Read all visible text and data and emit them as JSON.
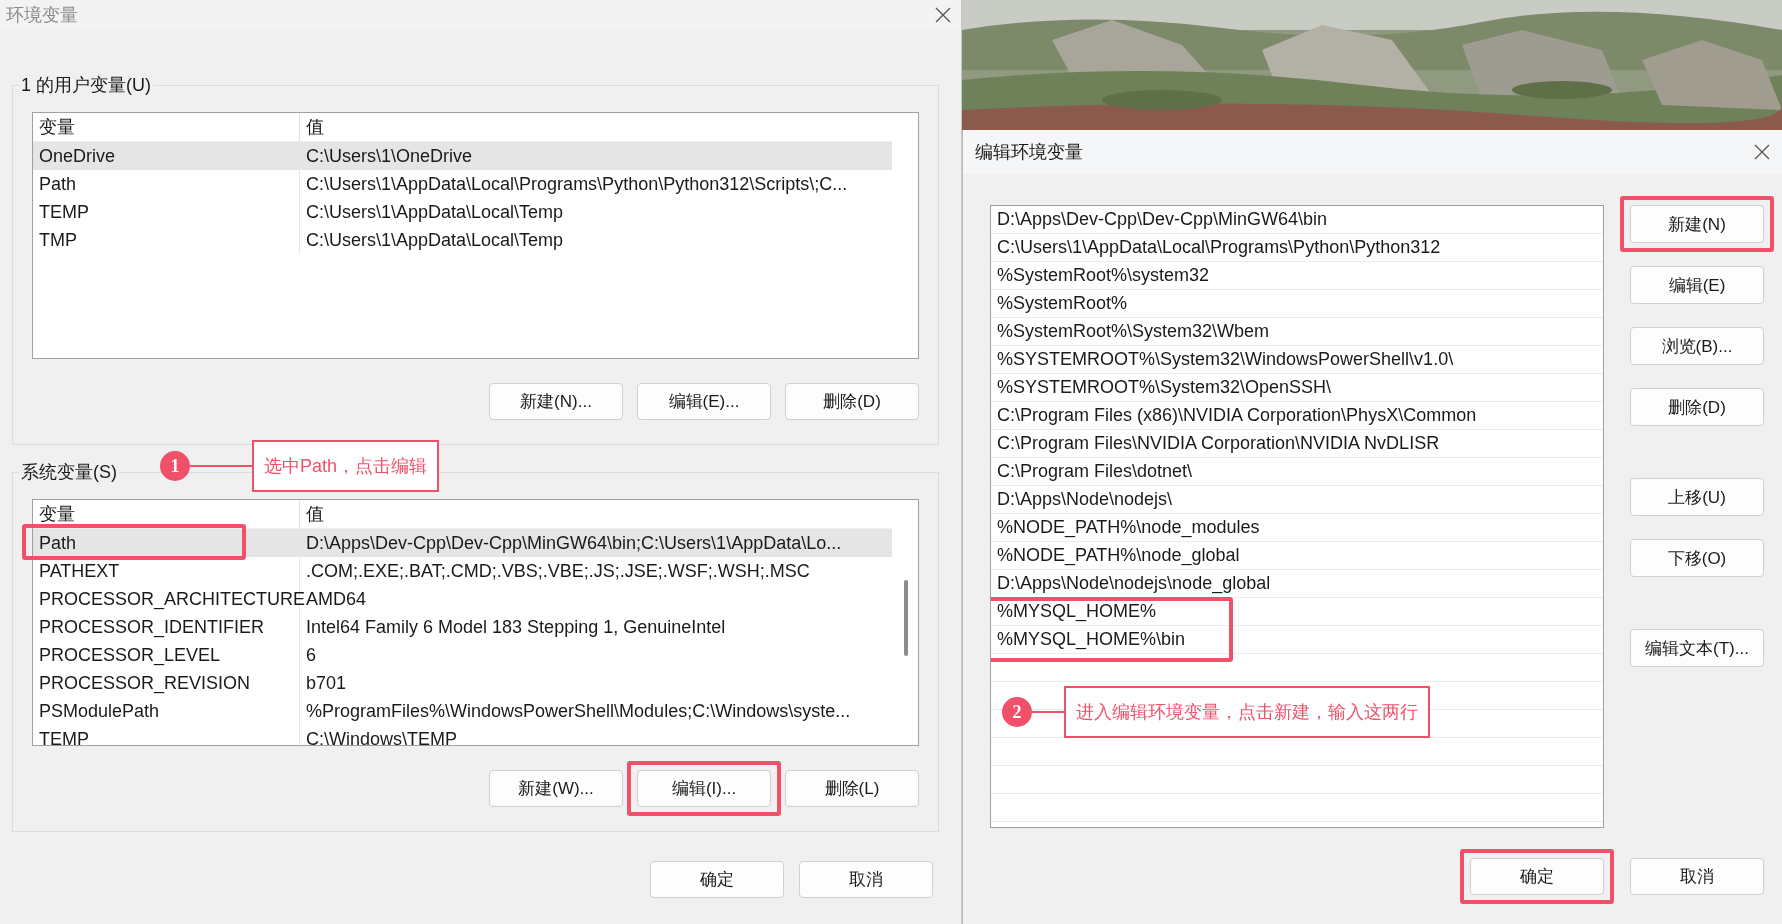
{
  "env_window": {
    "title": "环境变量",
    "user_vars": {
      "label": "1 的用户变量(U)",
      "columns": [
        "变量",
        "值"
      ],
      "rows": [
        {
          "name": "OneDrive",
          "value": "C:\\Users\\1\\OneDrive",
          "selected": true,
          "highlighted": false
        },
        {
          "name": "Path",
          "value": "C:\\Users\\1\\AppData\\Local\\Programs\\Python\\Python312\\Scripts\\;C...",
          "selected": false,
          "highlighted": false
        },
        {
          "name": "TEMP",
          "value": "C:\\Users\\1\\AppData\\Local\\Temp",
          "selected": false,
          "highlighted": false
        },
        {
          "name": "TMP",
          "value": "C:\\Users\\1\\AppData\\Local\\Temp",
          "selected": false,
          "highlighted": false
        }
      ],
      "buttons": [
        {
          "label": "新建(N)...",
          "highlighted": false
        },
        {
          "label": "编辑(E)...",
          "highlighted": false
        },
        {
          "label": "删除(D)",
          "highlighted": false
        }
      ]
    },
    "system_vars": {
      "label": "系统变量(S)",
      "columns": [
        "变量",
        "值"
      ],
      "rows": [
        {
          "name": "Path",
          "value": "D:\\Apps\\Dev-Cpp\\Dev-Cpp\\MinGW64\\bin;C:\\Users\\1\\AppData\\Lo...",
          "selected": true,
          "highlighted": true
        },
        {
          "name": "PATHEXT",
          "value": ".COM;.EXE;.BAT;.CMD;.VBS;.VBE;.JS;.JSE;.WSF;.WSH;.MSC",
          "selected": false,
          "highlighted": false
        },
        {
          "name": "PROCESSOR_ARCHITECTURE",
          "value": "AMD64",
          "selected": false,
          "highlighted": false
        },
        {
          "name": "PROCESSOR_IDENTIFIER",
          "value": "Intel64 Family 6 Model 183 Stepping 1, GenuineIntel",
          "selected": false,
          "highlighted": false
        },
        {
          "name": "PROCESSOR_LEVEL",
          "value": "6",
          "selected": false,
          "highlighted": false
        },
        {
          "name": "PROCESSOR_REVISION",
          "value": "b701",
          "selected": false,
          "highlighted": false
        },
        {
          "name": "PSModulePath",
          "value": "%ProgramFiles%\\WindowsPowerShell\\Modules;C:\\Windows\\syste...",
          "selected": false,
          "highlighted": false
        },
        {
          "name": "TEMP",
          "value": "C:\\Windows\\TEMP",
          "selected": false,
          "highlighted": false
        }
      ],
      "buttons": [
        {
          "label": "新建(W)...",
          "highlighted": false
        },
        {
          "label": "编辑(I)...",
          "highlighted": true
        },
        {
          "label": "删除(L)",
          "highlighted": false
        }
      ]
    },
    "buttons": [
      {
        "label": "确定",
        "highlighted": false
      },
      {
        "label": "取消",
        "highlighted": false
      }
    ]
  },
  "edit_window": {
    "title": "编辑环境变量",
    "entries": [
      {
        "text": "D:\\Apps\\Dev-Cpp\\Dev-Cpp\\MinGW64\\bin",
        "selected": false,
        "highlighted": false
      },
      {
        "text": "C:\\Users\\1\\AppData\\Local\\Programs\\Python\\Python312",
        "selected": false,
        "highlighted": false
      },
      {
        "text": "%SystemRoot%\\system32",
        "selected": false,
        "highlighted": false
      },
      {
        "text": "%SystemRoot%",
        "selected": false,
        "highlighted": false
      },
      {
        "text": "%SystemRoot%\\System32\\Wbem",
        "selected": false,
        "highlighted": false
      },
      {
        "text": "%SYSTEMROOT%\\System32\\WindowsPowerShell\\v1.0\\",
        "selected": false,
        "highlighted": false
      },
      {
        "text": "%SYSTEMROOT%\\System32\\OpenSSH\\",
        "selected": false,
        "highlighted": false
      },
      {
        "text": "C:\\Program Files (x86)\\NVIDIA Corporation\\PhysX\\Common",
        "selected": false,
        "highlighted": false
      },
      {
        "text": "C:\\Program Files\\NVIDIA Corporation\\NVIDIA NvDLISR",
        "selected": false,
        "highlighted": false
      },
      {
        "text": "C:\\Program Files\\dotnet\\",
        "selected": false,
        "highlighted": false
      },
      {
        "text": "D:\\Apps\\Node\\nodejs\\",
        "selected": false,
        "highlighted": false
      },
      {
        "text": "%NODE_PATH%\\node_modules",
        "selected": false,
        "highlighted": false
      },
      {
        "text": "%NODE_PATH%\\node_global",
        "selected": false,
        "highlighted": false
      },
      {
        "text": "D:\\Apps\\Node\\nodejs\\node_global",
        "selected": false,
        "highlighted": false
      },
      {
        "text": "%MYSQL_HOME%",
        "selected": false,
        "highlighted": true
      },
      {
        "text": "%MYSQL_HOME%\\bin",
        "selected": false,
        "highlighted": true
      }
    ],
    "button_groups": [
      [
        {
          "label": "新建(N)",
          "highlighted": true
        },
        {
          "label": "编辑(E)",
          "highlighted": false
        },
        {
          "label": "浏览(B)...",
          "highlighted": false
        },
        {
          "label": "删除(D)",
          "highlighted": false
        }
      ],
      [
        {
          "label": "上移(U)",
          "highlighted": false
        },
        {
          "label": "下移(O)",
          "highlighted": false
        }
      ],
      [
        {
          "label": "编辑文本(T)...",
          "highlighted": false
        }
      ]
    ],
    "buttons": [
      {
        "label": "确定",
        "highlighted": true
      },
      {
        "label": "取消",
        "highlighted": false
      }
    ]
  },
  "annotations": [
    {
      "number": "1",
      "text": "选中Path，点击编辑"
    },
    {
      "number": "2",
      "text": "进入编辑环境变量，点击新建，输入这两行"
    }
  ]
}
